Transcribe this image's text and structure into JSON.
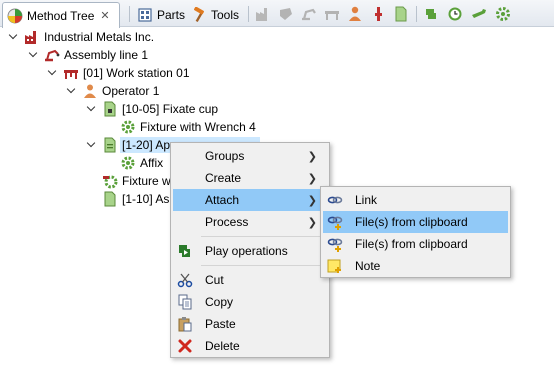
{
  "tabs": [
    {
      "label": "Method Tree",
      "icon": "method-tree-icon",
      "active": true
    },
    {
      "label": "Parts",
      "icon": "parts-icon",
      "active": false
    },
    {
      "label": "Tools",
      "icon": "hammer-icon",
      "active": false
    }
  ],
  "tab_close_glyph": "✕",
  "toolbar_icons": [
    "factory-icon",
    "cup-icon",
    "robot-arm-icon",
    "workstation-icon",
    "operator-icon",
    "tool-icon",
    "document-icon",
    "assembly-icon",
    "clock-icon",
    "wrench-icon",
    "gear-icon"
  ],
  "tree": {
    "company": "Industrial Metals Inc.",
    "line": "Assembly line 1",
    "station": "[01] Work station 01",
    "operator": "Operator 1",
    "op1": "[10-05] Fixate cup",
    "op1_child": "Fixture with Wrench 4",
    "op2": "[1-20] Ap",
    "op2_child": "Affix",
    "item_fixture": "Fixture w",
    "op3": "[1-10] As"
  },
  "context_menu": {
    "groups": "Groups",
    "create": "Create",
    "attach": "Attach",
    "process": "Process",
    "play": "Play operations",
    "cut": "Cut",
    "copy": "Copy",
    "paste": "Paste",
    "delete": "Delete"
  },
  "submenu": {
    "link": "Link",
    "files_highlighted": "File(s) from clipboard",
    "files": "File(s) from clipboard",
    "note": "Note"
  },
  "colors": {
    "selection": "#cce8ff",
    "menu_highlight": "#91c9f7",
    "menu_bg": "#f0f0f0"
  }
}
